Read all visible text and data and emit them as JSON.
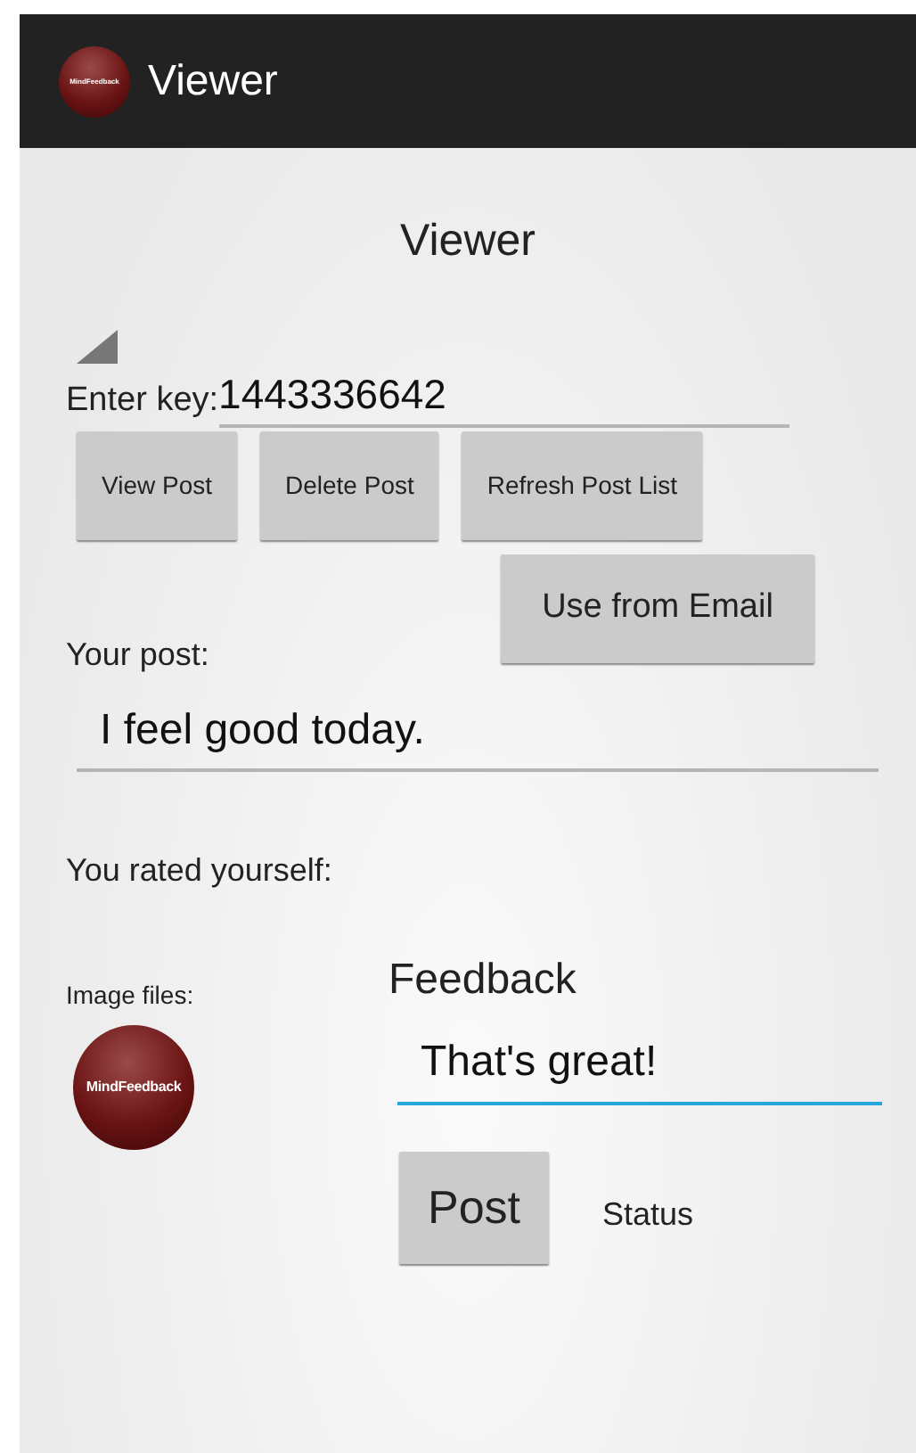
{
  "action_bar": {
    "logo_text": "MindFeedback",
    "title": "Viewer"
  },
  "heading": "Viewer",
  "key_field": {
    "label": "Enter key:",
    "value": "1443336642",
    "focused": false
  },
  "buttons": [
    {
      "label": "View Post"
    },
    {
      "label": "Delete Post"
    },
    {
      "label": "Refresh Post List"
    }
  ],
  "email_button": {
    "label": "Use from Email"
  },
  "post_label": "Your post:",
  "post_field": {
    "value": "I feel good today.",
    "focused": false
  },
  "rating_label": "You rated yourself:",
  "image_files": {
    "label": "Image files:",
    "logo_text": "MindFeedback"
  },
  "feedback": {
    "label": "Feedback",
    "value": "That's great!",
    "focused": true
  },
  "post_button": {
    "label": "Post"
  },
  "status": "Status"
}
